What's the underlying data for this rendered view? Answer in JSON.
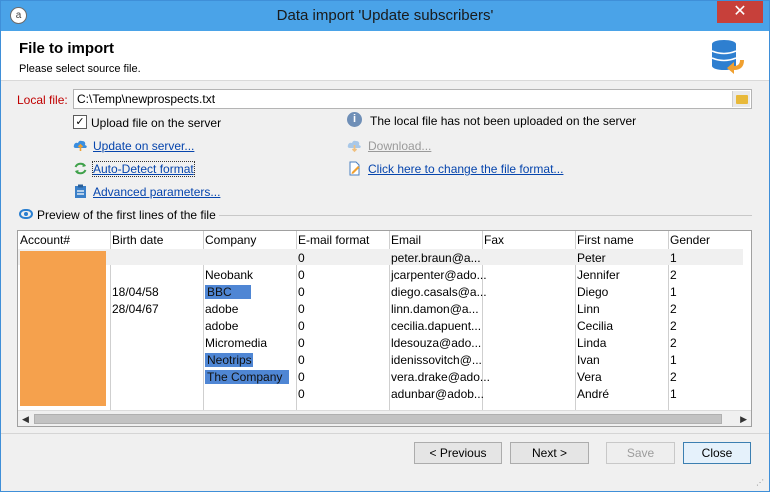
{
  "window": {
    "title": "Data import 'Update subscribers'",
    "close_glyph": "✕"
  },
  "header": {
    "title": "File to import",
    "subtitle": "Please select source file."
  },
  "local_file": {
    "label": "Local file:",
    "value": "C:\\Temp\\newprospects.txt"
  },
  "upload": {
    "checked": true,
    "label": "Upload file on the server",
    "info": "The local file has not been uploaded on the server"
  },
  "links": {
    "update_on_server": "Update on server...",
    "download": "Download...",
    "auto_detect": "Auto-Detect format",
    "change_format": "Click here to change the file format...",
    "advanced": "Advanced parameters..."
  },
  "preview": {
    "label": "Preview of the first lines of the file",
    "columns": [
      "Account#",
      "Birth date",
      "Company",
      "E-mail format",
      "Email",
      "Fax",
      "First name",
      "Gender"
    ],
    "rows": [
      {
        "birth": "",
        "company": "",
        "emailfmt": "0",
        "email": "peter.braun@a...",
        "first": "Peter",
        "gender": "1"
      },
      {
        "birth": "",
        "company": "Neobank",
        "emailfmt": "0",
        "email": "jcarpenter@ado...",
        "first": "Jennifer",
        "gender": "2"
      },
      {
        "birth": "18/04/58",
        "company": "BBC",
        "emailfmt": "0",
        "email": "diego.casals@a...",
        "first": "Diego",
        "gender": "1"
      },
      {
        "birth": "28/04/67",
        "company": "adobe",
        "emailfmt": "0",
        "email": "linn.damon@a...",
        "first": "Linn",
        "gender": "2"
      },
      {
        "birth": "",
        "company": "adobe",
        "emailfmt": "0",
        "email": "cecilia.dapuent...",
        "first": "Cecilia",
        "gender": "2"
      },
      {
        "birth": "",
        "company": "Micromedia",
        "emailfmt": "0",
        "email": "ldesouza@ado...",
        "first": "Linda",
        "gender": "2"
      },
      {
        "birth": "",
        "company": "Neotrips",
        "emailfmt": "0",
        "email": "idenissovitch@...",
        "first": "Ivan",
        "gender": "1"
      },
      {
        "birth": "",
        "company": "The Company",
        "emailfmt": "0",
        "email": "vera.drake@ado...",
        "first": "Vera",
        "gender": "2"
      },
      {
        "birth": "",
        "company": "",
        "emailfmt": "0",
        "email": "adunbar@adob...",
        "first": "André",
        "gender": "1"
      }
    ]
  },
  "buttons": {
    "previous": "< Previous",
    "next": "Next >",
    "save": "Save",
    "close": "Close"
  },
  "colors": {
    "titlebar": "#4aa3e8",
    "highlight_orange": "#f5a14d",
    "selection_blue": "#4f86d4",
    "required_red": "#c00000"
  }
}
